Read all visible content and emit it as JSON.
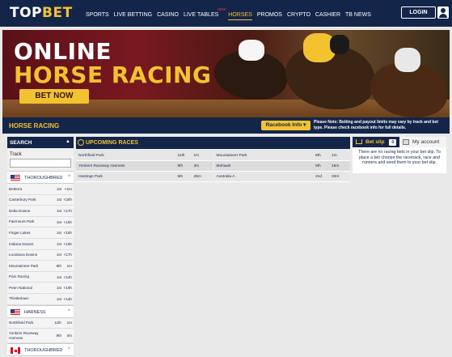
{
  "header": {
    "logo_top": "TOP",
    "logo_bet": "BET",
    "nav": [
      "SPORTS",
      "LIVE BETTING",
      "CASINO",
      "LIVE TABLES",
      "HORSES",
      "PROMOS",
      "CRYPTO",
      "CASHIER",
      "TB NEWS"
    ],
    "active_nav": "HORSES",
    "new_badge": "NEW",
    "login_label": "LOGIN"
  },
  "hero": {
    "title_line1": "ONLINE",
    "title_line2": "HORSE RACING",
    "cta_label": "BET NOW"
  },
  "racing_bar": {
    "title": "HORSE RACING",
    "racebook_info_label": "Racebook Info ▾",
    "note": "Please Note: Betting and payout limits may vary by track and bet type. Please check racebook info for full details."
  },
  "search": {
    "title": "SEARCH",
    "track_label": "Track",
    "track_value": "",
    "groups": [
      {
        "flag": "us",
        "label": "THOROUGHBRED",
        "rows": [
          {
            "name": "Betterra",
            "race": "1st",
            "mins": "<1m"
          },
          {
            "name": "Canterbury Park",
            "race": "1st",
            "mins": "<20h"
          },
          {
            "name": "Delta Downs",
            "race": "1st",
            "mins": "<17h"
          },
          {
            "name": "Fairmount Park",
            "race": "1st",
            "mins": "<15h"
          },
          {
            "name": "Finger Lakes",
            "race": "1st",
            "mins": "<15h"
          },
          {
            "name": "Indiana Downs",
            "race": "1st",
            "mins": "<16h"
          },
          {
            "name": "Louisiana Downs",
            "race": "1st",
            "mins": "<17h"
          },
          {
            "name": "Mountaineer Park",
            "race": "8th",
            "mins": "1m"
          },
          {
            "name": "Parx Racing",
            "race": "1st",
            "mins": "<14h"
          },
          {
            "name": "Penn National",
            "race": "1st",
            "mins": "<19h"
          },
          {
            "name": "Thistledown",
            "race": "1st",
            "mins": "<14h"
          }
        ]
      },
      {
        "flag": "us",
        "label": "HARNESS",
        "rows": [
          {
            "name": "Northfield Park",
            "race": "11th",
            "mins": "1m"
          },
          {
            "name": "Yonkers Raceway Harness",
            "race": "9th",
            "mins": "4m"
          }
        ]
      },
      {
        "flag": "ca",
        "label": "THOROUGHBRED",
        "rows": []
      }
    ]
  },
  "upcoming": {
    "title": "UPCOMING RACES",
    "left": [
      {
        "name": "Northfield Park",
        "race": "11th",
        "mins": "1m"
      },
      {
        "name": "Yonkers Raceway Harness",
        "race": "9th",
        "mins": "4m"
      },
      {
        "name": "Hastings Park",
        "race": "6th",
        "mins": "25m"
      }
    ],
    "right": [
      {
        "name": "Mountaineer Park",
        "race": "8th",
        "mins": "1m"
      },
      {
        "name": "Mohawk",
        "race": "9th",
        "mins": "15m"
      },
      {
        "name": "Australia A",
        "race": "2nd",
        "mins": "33m"
      }
    ]
  },
  "betslip": {
    "tab_betslip": "Bet slip",
    "count": "0",
    "tab_account": "My account",
    "empty_message": "There are no racing bets in your bet slip. To place a bet choose the racetrack, race and runners and send them to your bet slip."
  },
  "colors": {
    "navy": "#14254a",
    "gold": "#f2c230",
    "page_bg": "#e9e9e9"
  },
  "icons": [
    "user-icon",
    "clock-icon",
    "cart-icon",
    "account-icon",
    "chevron-up-icon",
    "us-flag-icon",
    "canada-flag-icon"
  ]
}
